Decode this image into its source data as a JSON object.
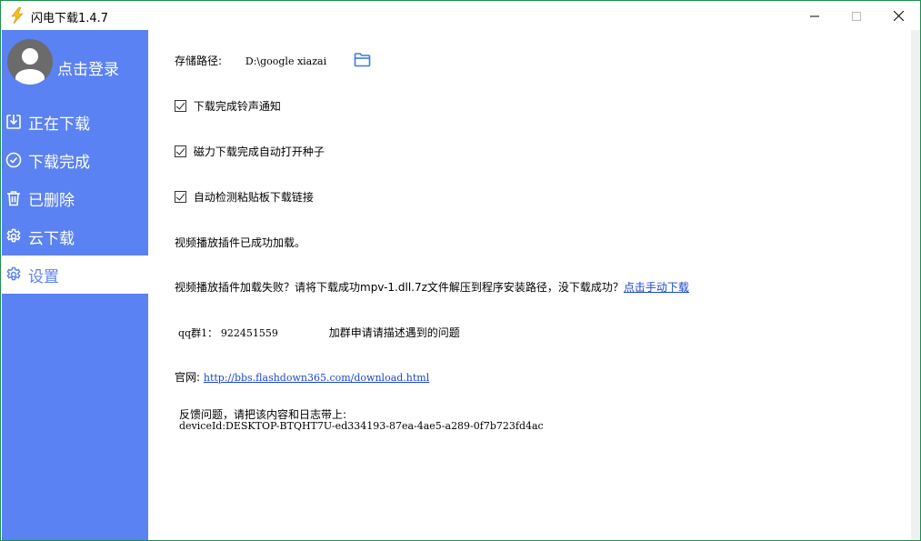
{
  "window": {
    "title": "闪电下载1.4.7",
    "icons": {
      "app": "lightning-icon",
      "minimize": "minimize-icon",
      "maximize": "maximize-icon",
      "close": "close-icon"
    }
  },
  "sidebar": {
    "login_label": "点击登录",
    "avatar_icon": "user-avatar-icon",
    "items": [
      {
        "label": "正在下载",
        "icon": "download-tray-icon",
        "active": false
      },
      {
        "label": "下载完成",
        "icon": "check-circle-icon",
        "active": false
      },
      {
        "label": "已删除",
        "icon": "trash-icon",
        "active": false
      },
      {
        "label": "云下载",
        "icon": "gear-icon",
        "active": false
      },
      {
        "label": "设置",
        "icon": "gear-icon",
        "active": true
      }
    ],
    "colors": {
      "background": "#5b82f2",
      "active_background": "#ffffff",
      "text": "#ffffff"
    }
  },
  "settings": {
    "storage_path_label": "存储路径:",
    "storage_path_value": "D:\\google xiazai",
    "folder_icon": "folder-open-icon",
    "options": [
      {
        "label": "下载完成铃声通知",
        "checked": true
      },
      {
        "label": "磁力下载完成自动打开种子",
        "checked": true
      },
      {
        "label": "自动检测粘贴板下载链接",
        "checked": true
      }
    ],
    "plugin_loaded_text": "视频播放插件已成功加载。",
    "plugin_fail_text": "视频播放插件加载失败？请将下载成功mpv-1.dll.7z文件解压到程序安装路径，没下载成功？",
    "plugin_fail_link": "点击手动下载",
    "qq_group_label": "qq群1：",
    "qq_group_number": "922451559",
    "qq_group_note": "加群申请请描述遇到的问题",
    "website_label": "官网:",
    "website_url": "http://bbs.flashdown365.com/download.html",
    "feedback_text": "反馈问题，请把该内容和日志带上:",
    "device_id": "deviceId:DESKTOP-BTQHT7U-ed334193-87ea-4ae5-a289-0f7b723fd4ac"
  },
  "colors": {
    "link": "#1a47d1",
    "accent": "#5b82f2",
    "icon_blue": "#3d7be3"
  }
}
